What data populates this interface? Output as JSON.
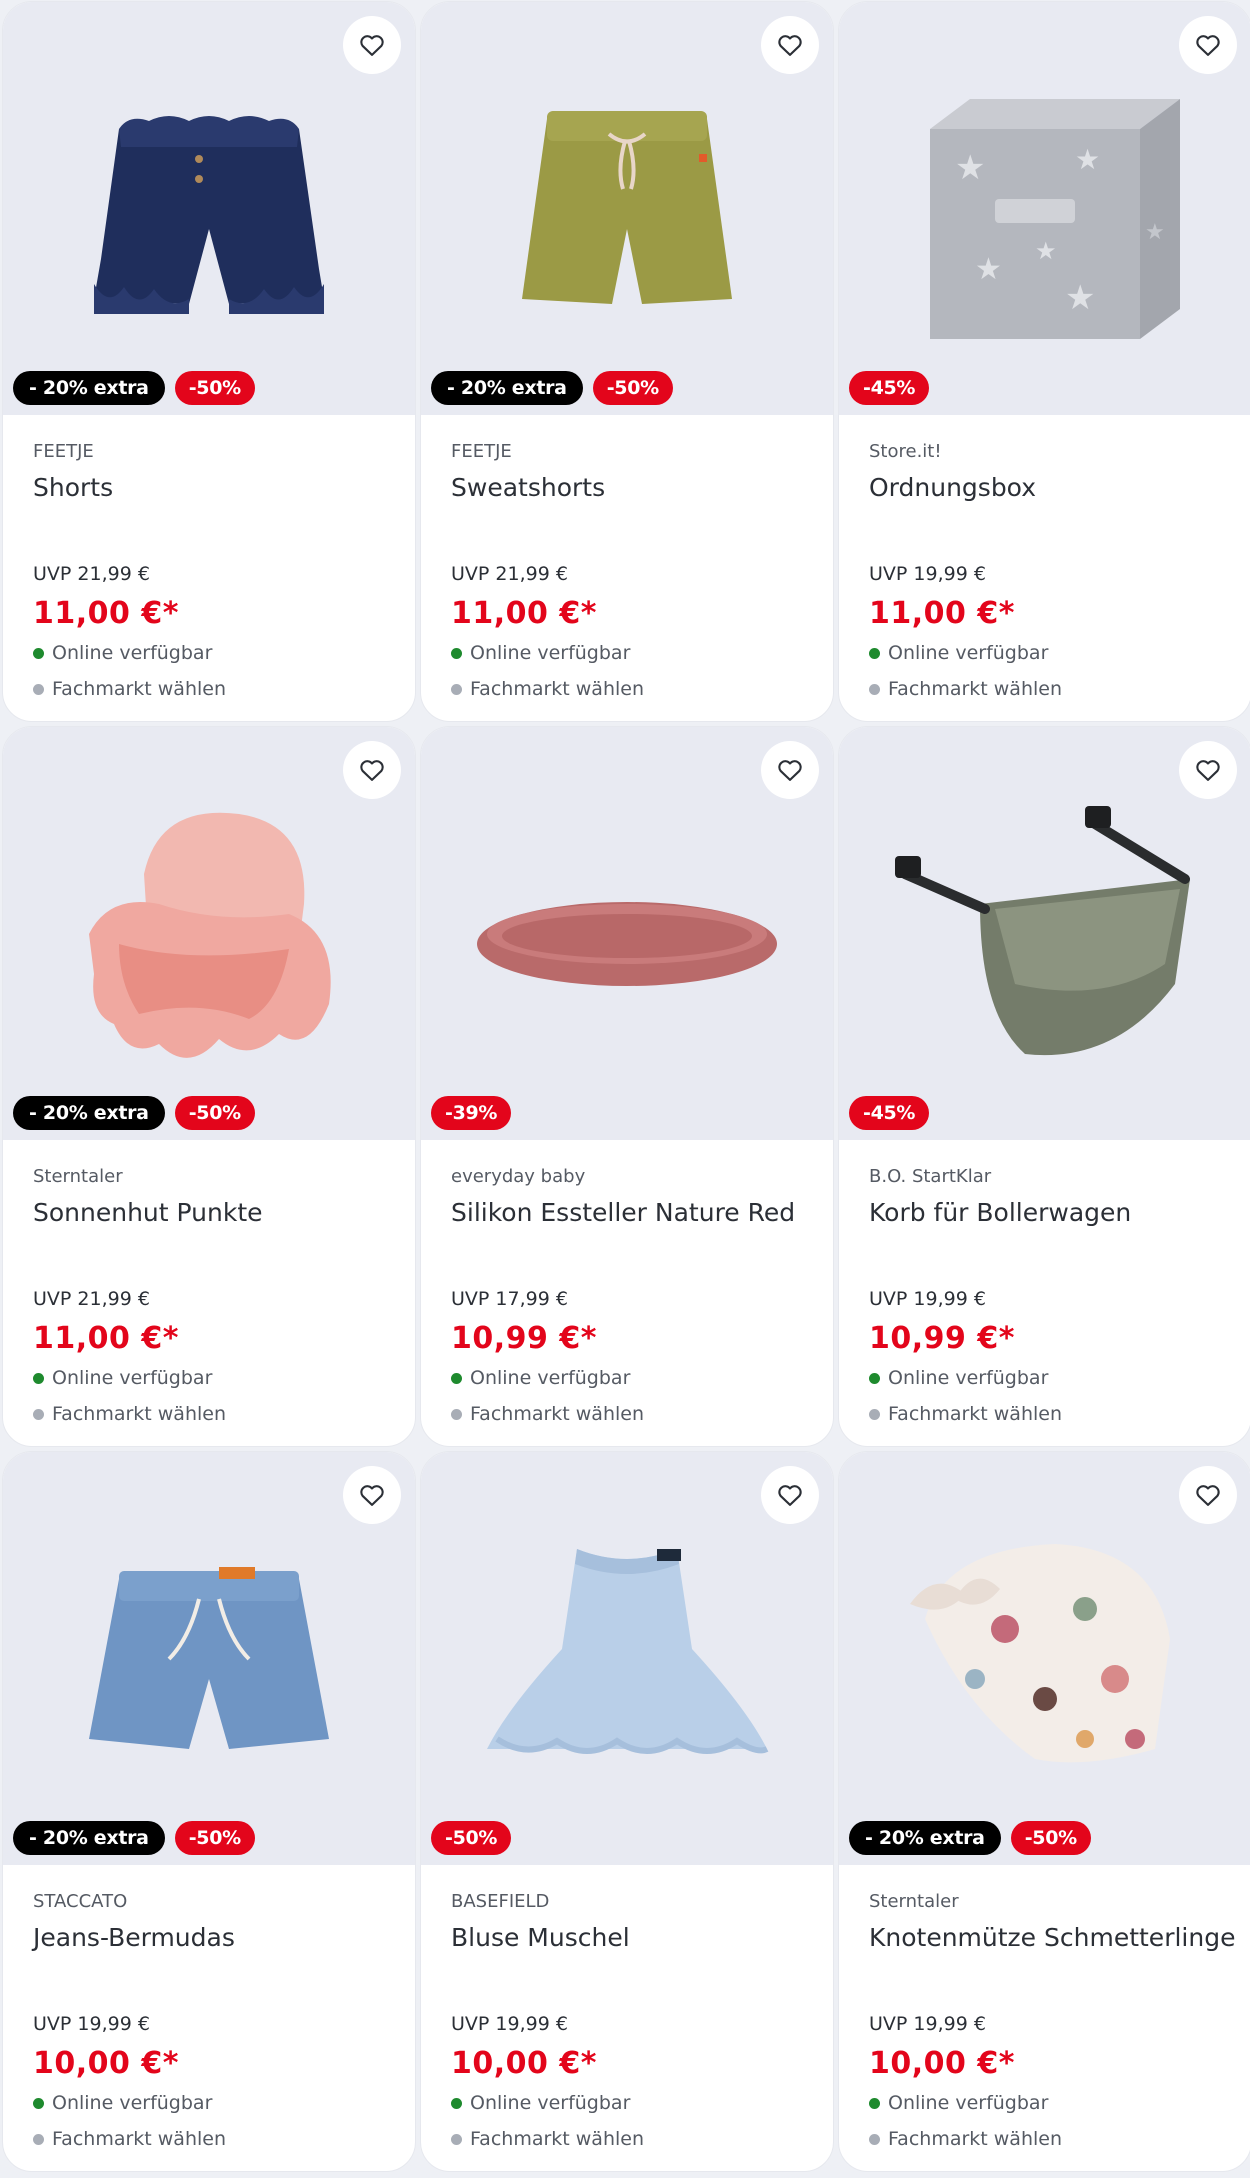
{
  "colors": {
    "accent_red": "#e3051b",
    "badge_black": "#000000",
    "available_green": "#1e8a2e",
    "store_grey": "#a8adb6",
    "media_background": "#e8eaf2"
  },
  "icons": {
    "favorite": "heart-outline-icon",
    "online_status": "green-dot-icon",
    "store_status": "grey-dot-icon"
  },
  "products": [
    {
      "brand": "FEETJE",
      "name": "Shorts",
      "uvp": "UVP 21,99 €",
      "price": "11,00 €*",
      "badge_extra": "- 20% extra",
      "badge_discount": "-50%",
      "online": "Online verfügbar",
      "store": "Fachmarkt wählen",
      "image": "navy-denim-shorts"
    },
    {
      "brand": "FEETJE",
      "name": "Sweatshorts",
      "uvp": "UVP 21,99 €",
      "price": "11,00 €*",
      "badge_extra": "- 20% extra",
      "badge_discount": "-50%",
      "online": "Online verfügbar",
      "store": "Fachmarkt wählen",
      "image": "olive-sweatshorts"
    },
    {
      "brand": "Store.it!",
      "name": "Ordnungsbox",
      "uvp": "UVP 19,99 €",
      "price": "11,00 €*",
      "badge_extra": "",
      "badge_discount": "-45%",
      "online": "Online verfügbar",
      "store": "Fachmarkt wählen",
      "image": "grey-star-storage-box"
    },
    {
      "brand": "Sterntaler",
      "name": "Sonnenhut Punkte",
      "uvp": "UVP 21,99 €",
      "price": "11,00 €*",
      "badge_extra": "- 20% extra",
      "badge_discount": "-50%",
      "online": "Online verfügbar",
      "store": "Fachmarkt wählen",
      "image": "pink-sun-hat"
    },
    {
      "brand": "everyday baby",
      "name": "Silikon Essteller Nature Red",
      "uvp": "UVP 17,99 €",
      "price": "10,99 €*",
      "badge_extra": "",
      "badge_discount": "-39%",
      "online": "Online verfügbar",
      "store": "Fachmarkt wählen",
      "image": "red-silicone-plate"
    },
    {
      "brand": "B.O. StartKlar",
      "name": "Korb für Bollerwagen",
      "uvp": "UVP 19,99 €",
      "price": "10,99 €*",
      "badge_extra": "",
      "badge_discount": "-45%",
      "online": "Online verfügbar",
      "store": "Fachmarkt wählen",
      "image": "olive-wagon-basket"
    },
    {
      "brand": "STACCATO",
      "name": "Jeans-Bermudas",
      "uvp": "UVP 19,99 €",
      "price": "10,00 €*",
      "badge_extra": "- 20% extra",
      "badge_discount": "-50%",
      "online": "Online verfügbar",
      "store": "Fachmarkt wählen",
      "image": "light-denim-shorts"
    },
    {
      "brand": "BASEFIELD",
      "name": "Bluse Muschel",
      "uvp": "UVP 19,99 €",
      "price": "10,00 €*",
      "badge_extra": "",
      "badge_discount": "-50%",
      "online": "Online verfügbar",
      "store": "Fachmarkt wählen",
      "image": "light-blue-blouse"
    },
    {
      "brand": "Sterntaler",
      "name": "Knotenmütze Schmetterlinge",
      "uvp": "UVP 19,99 €",
      "price": "10,00 €*",
      "badge_extra": "- 20% extra",
      "badge_discount": "-50%",
      "online": "Online verfügbar",
      "store": "Fachmarkt wählen",
      "image": "butterfly-knot-hat"
    }
  ]
}
